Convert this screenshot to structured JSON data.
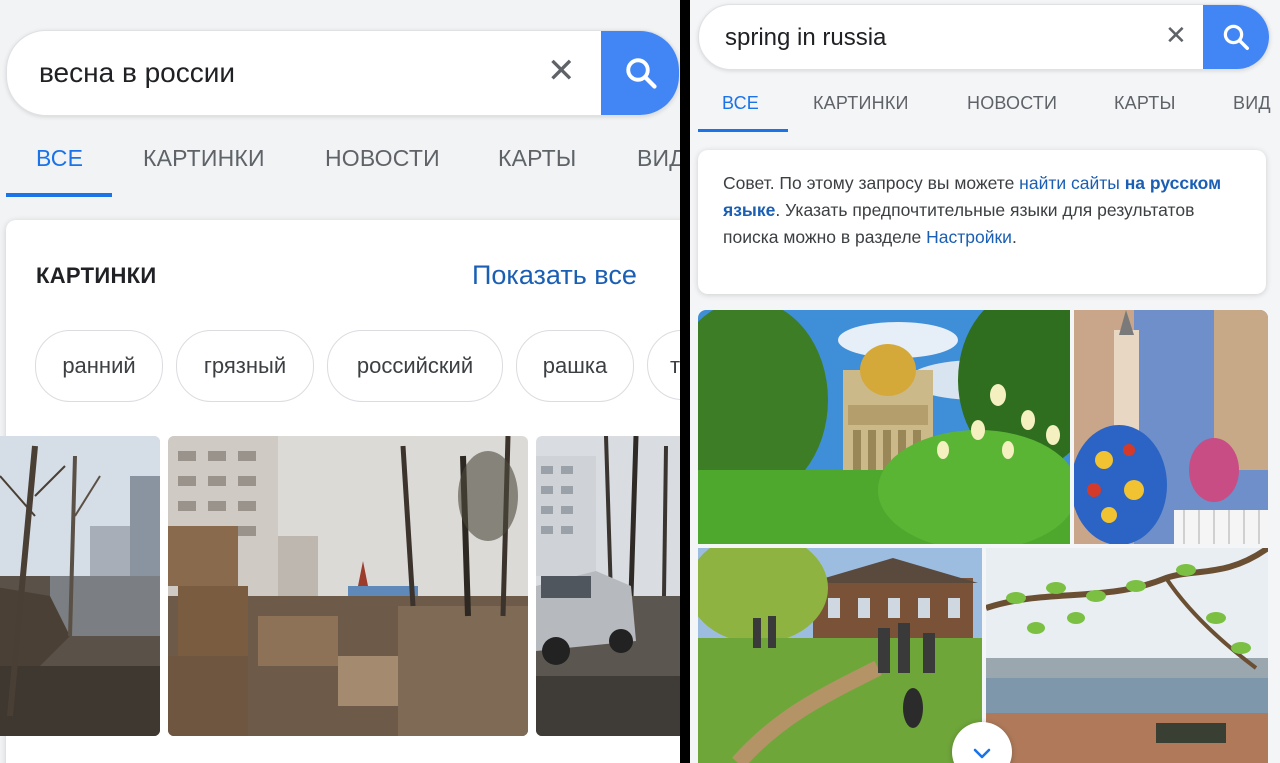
{
  "left": {
    "search": {
      "query": "весна в россии",
      "clear_icon": "close-icon",
      "search_icon": "search-icon",
      "accent": "#4285f4"
    },
    "tabs": [
      "ВСЕ",
      "КАРТИНКИ",
      "НОВОСТИ",
      "КАРТЫ",
      "ВИД"
    ],
    "images_section": {
      "title": "КАРТИНКИ",
      "show_all": "Показать все",
      "chips": [
        "ранний",
        "грязный",
        "российский",
        "рашка",
        "т"
      ]
    }
  },
  "right": {
    "search": {
      "query": "spring in russia",
      "clear_icon": "close-icon",
      "search_icon": "search-icon"
    },
    "tabs": [
      "ВСЕ",
      "КАРТИНКИ",
      "НОВОСТИ",
      "КАРТЫ",
      "ВИД"
    ],
    "tip": {
      "part1": "Совет. По этому запросу вы можете ",
      "link1": "найти сайты",
      "link1_bold": "на русском языке",
      "part2": ". Указать предпочтительные языки для результатов поиска можно в разделе ",
      "link2": "Настройки",
      "part3": "."
    },
    "expand_icon": "chevron-down-icon"
  },
  "colors": {
    "link": "#1a73e8",
    "text": "#202124",
    "muted": "#5f6368"
  }
}
